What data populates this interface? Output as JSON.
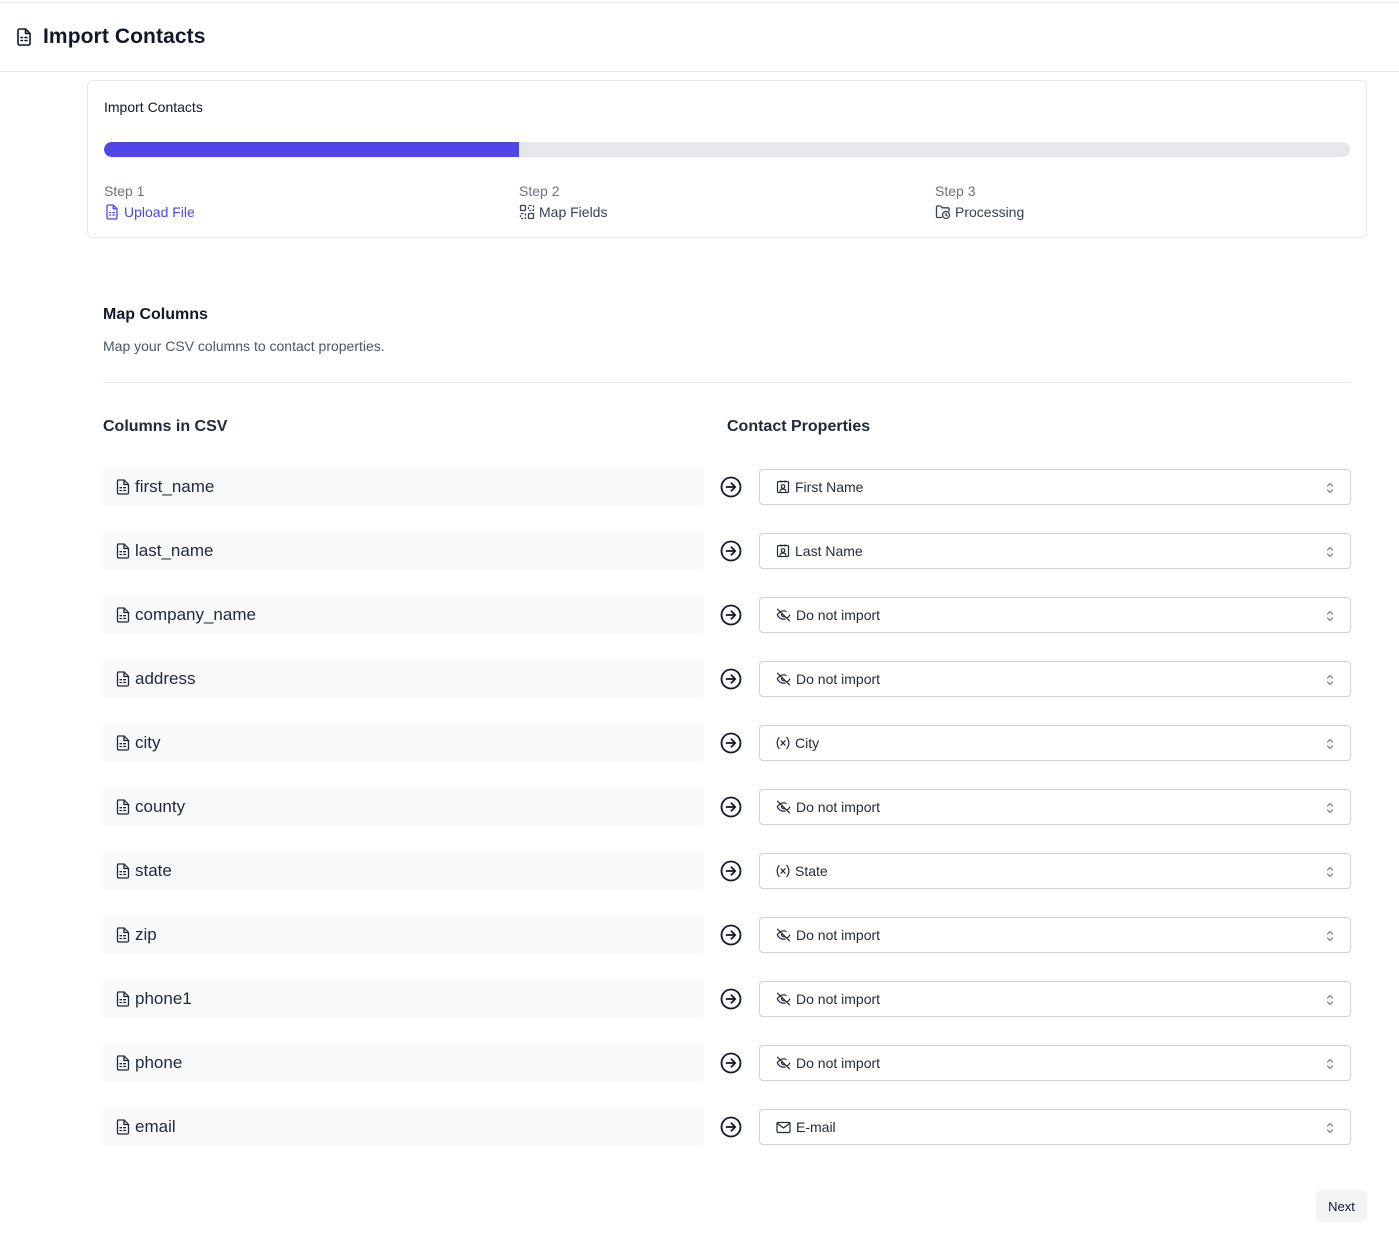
{
  "header": {
    "title": "Import Contacts",
    "icon": "file-icon"
  },
  "stepper": {
    "title": "Import Contacts",
    "progress_percent": 33.3,
    "accent_color": "#5046e5",
    "steps": [
      {
        "num": "Step 1",
        "label": "Upload File",
        "icon": "file-icon",
        "active": true
      },
      {
        "num": "Step 2",
        "label": "Map Fields",
        "icon": "map-fields-icon",
        "active": false
      },
      {
        "num": "Step 3",
        "label": "Processing",
        "icon": "folder-clock-icon",
        "active": false
      }
    ]
  },
  "mapping": {
    "title": "Map Columns",
    "description": "Map your CSV columns to contact properties.",
    "col_csv_header": "Columns in CSV",
    "col_props_header": "Contact Properties",
    "rows": [
      {
        "column": "first_name",
        "property": "First Name",
        "icon": "contact-icon"
      },
      {
        "column": "last_name",
        "property": "Last Name",
        "icon": "contact-icon"
      },
      {
        "column": "company_name",
        "property": "Do not import",
        "icon": "eye-off-icon"
      },
      {
        "column": "address",
        "property": "Do not import",
        "icon": "eye-off-icon"
      },
      {
        "column": "city",
        "property": "City",
        "icon": "variable-icon"
      },
      {
        "column": "county",
        "property": "Do not import",
        "icon": "eye-off-icon"
      },
      {
        "column": "state",
        "property": "State",
        "icon": "variable-icon"
      },
      {
        "column": "zip",
        "property": "Do not import",
        "icon": "eye-off-icon"
      },
      {
        "column": "phone1",
        "property": "Do not import",
        "icon": "eye-off-icon"
      },
      {
        "column": "phone",
        "property": "Do not import",
        "icon": "eye-off-icon"
      },
      {
        "column": "email",
        "property": "E-mail",
        "icon": "mail-icon"
      }
    ]
  },
  "footer": {
    "next_label": "Next"
  }
}
